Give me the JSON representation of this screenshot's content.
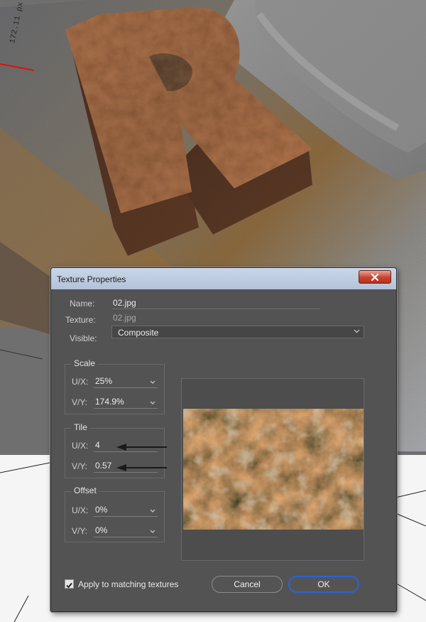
{
  "viewport": {
    "ruler_text": "172.11 px"
  },
  "dialog": {
    "title": "Texture Properties",
    "name_label": "Name:",
    "name_value": "02.jpg",
    "texture_label": "Texture:",
    "texture_value": "02.jpg",
    "visible_label": "Visible:",
    "visible_value": "Composite",
    "scale": {
      "title": "Scale",
      "ux_label": "U/X:",
      "ux_value": "25%",
      "vy_label": "V/Y:",
      "vy_value": "174.9%"
    },
    "tile": {
      "title": "Tile",
      "ux_label": "U/X:",
      "ux_value": "4",
      "vy_label": "V/Y:",
      "vy_value": "0.57"
    },
    "offset": {
      "title": "Offset",
      "ux_label": "U/X:",
      "ux_value": "0%",
      "vy_label": "V/Y:",
      "vy_value": "0%"
    },
    "apply_label": "Apply to matching textures",
    "apply_checked": true,
    "cancel_label": "Cancel",
    "ok_label": "OK"
  },
  "colors": {
    "dialog_bg": "#535353",
    "titlebar": "#b9c8dd",
    "close_button": "#c7432f",
    "ok_border": "#2e62d6",
    "rust": "#7a4428"
  }
}
